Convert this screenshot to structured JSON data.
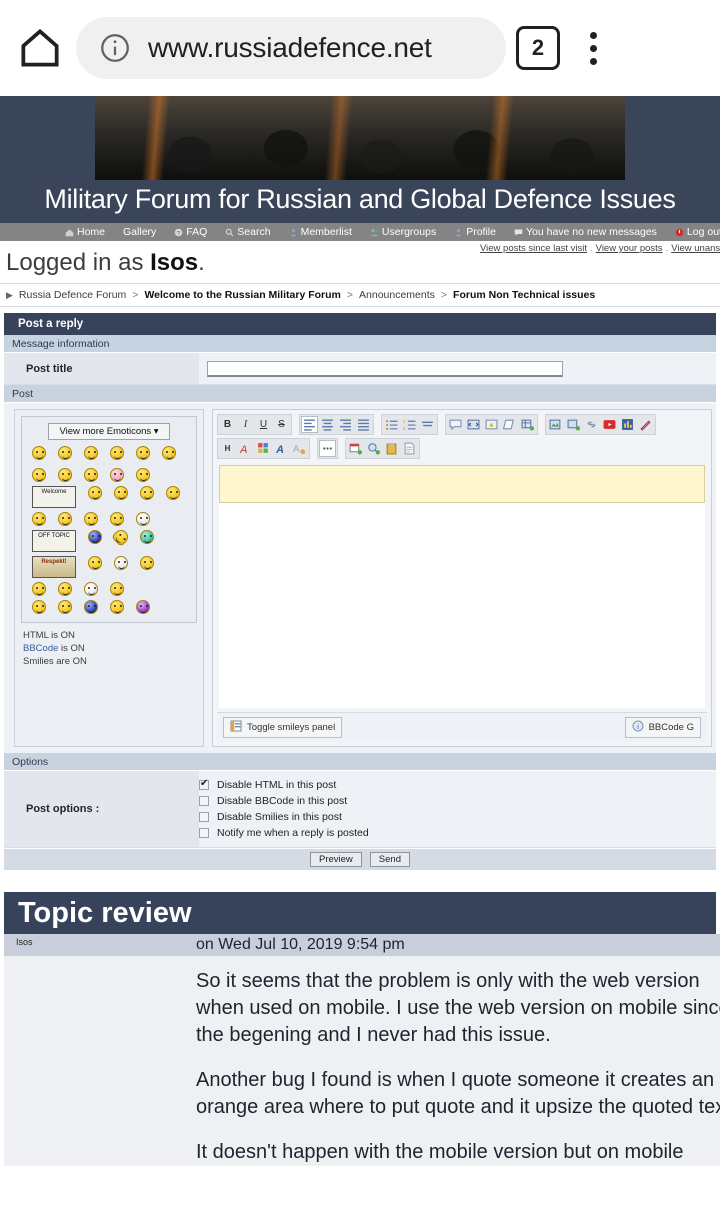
{
  "browser": {
    "home_icon": "home-icon",
    "info_icon": "info-icon",
    "url": "www.russiadefence.net",
    "tab_count": "2",
    "menu_icon": "overflow-menu-icon"
  },
  "site": {
    "banner_title": "Military Forum for Russian and Global Defence Issues"
  },
  "nav": {
    "items": [
      {
        "label": "Home",
        "icon": "home-icon"
      },
      {
        "label": "Gallery",
        "icon": "gallery-icon"
      },
      {
        "label": "FAQ",
        "icon": "faq-icon"
      },
      {
        "label": "Search",
        "icon": "search-icon"
      },
      {
        "label": "Memberlist",
        "icon": "memberlist-icon"
      },
      {
        "label": "Usergroups",
        "icon": "usergroups-icon"
      },
      {
        "label": "Profile",
        "icon": "profile-icon"
      },
      {
        "label": "You have no new messages",
        "icon": "messages-icon"
      },
      {
        "label": "Log out [ Iso",
        "icon": "logout-icon"
      }
    ]
  },
  "user": {
    "logged_prefix": "Logged in as",
    "username": "Isos",
    "logged_suffix": ".",
    "quicklinks": [
      "View posts since last visit",
      "View your posts",
      "View unanswered"
    ]
  },
  "breadcrumb": {
    "arrow_icon": "breadcrumb-arrow-icon",
    "items": [
      "Russia Defence Forum",
      "Welcome to the Russian Military Forum",
      "Announcements",
      "Forum Non Technical issues"
    ],
    "separator": ">"
  },
  "post_form": {
    "header": "Post a reply",
    "message_info_header": "Message information",
    "post_title_label": "Post title",
    "post_title_value": "",
    "post_header": "Post"
  },
  "smileys": {
    "view_more_label": "View more Emoticons",
    "dropdown_icon": "chevron-down-icon",
    "sign_welcome": "Welcome",
    "sign_offtopic": "OFF TOPIC",
    "sign_respekt": "Respekt!",
    "meta": {
      "html_status": "HTML is ON",
      "bbcode_link": "BBCode",
      "bbcode_status": "is ON",
      "smilies_status": "Smilies are ON"
    }
  },
  "toolbar": {
    "row1": [
      {
        "name": "bold-button",
        "glyph": "B"
      },
      {
        "name": "italic-button",
        "glyph": "I"
      },
      {
        "name": "underline-button",
        "glyph": "U"
      },
      {
        "name": "strikethrough-button",
        "glyph": "S"
      },
      {
        "name": "align-left-button",
        "glyph": "align-left-icon"
      },
      {
        "name": "align-center-button",
        "glyph": "align-center-icon"
      },
      {
        "name": "align-right-button",
        "glyph": "align-right-icon"
      },
      {
        "name": "align-justify-button",
        "glyph": "align-justify-icon"
      },
      {
        "name": "bullet-list-button",
        "glyph": "bullet-list-icon"
      },
      {
        "name": "numbered-list-button",
        "glyph": "numbered-list-icon"
      },
      {
        "name": "horizontal-rule-button",
        "glyph": "horizontal-rule-icon"
      },
      {
        "name": "quote-button",
        "glyph": "quote-icon"
      },
      {
        "name": "code-button",
        "glyph": "code-icon"
      },
      {
        "name": "spoiler-button",
        "glyph": "spoiler-icon"
      },
      {
        "name": "hide-button",
        "glyph": "hide-icon"
      },
      {
        "name": "table-button",
        "glyph": "table-icon"
      },
      {
        "name": "insert-image-button",
        "glyph": "image-icon"
      },
      {
        "name": "upload-image-button",
        "glyph": "upload-image-icon"
      },
      {
        "name": "insert-link-button",
        "glyph": "link-icon"
      },
      {
        "name": "youtube-button",
        "glyph": "youtube-icon"
      },
      {
        "name": "poll-button",
        "glyph": "chart-icon"
      },
      {
        "name": "signature-button",
        "glyph": "pen-icon"
      }
    ],
    "row2": [
      {
        "name": "heading-button",
        "glyph": "H"
      },
      {
        "name": "font-face-button",
        "glyph": "font-face-icon"
      },
      {
        "name": "font-color-button",
        "glyph": "color-palette-icon"
      },
      {
        "name": "font-size-button",
        "glyph": "font-size-icon"
      },
      {
        "name": "remove-format-button",
        "glyph": "remove-format-icon"
      },
      {
        "name": "more-button",
        "glyph": "ellipsis-icon"
      },
      {
        "name": "calendar-button",
        "glyph": "calendar-icon"
      },
      {
        "name": "search-insert-button",
        "glyph": "search-plus-icon"
      },
      {
        "name": "paste-button",
        "glyph": "clipboard-icon"
      },
      {
        "name": "page-button",
        "glyph": "page-icon"
      }
    ],
    "toggle_smileys_label": "Toggle smileys panel",
    "toggle_smileys_icon": "panel-icon",
    "bbcode_guide_label": "BBCode G",
    "bbcode_guide_icon": "info-icon"
  },
  "options": {
    "header": "Options",
    "label": "Post options :",
    "checkboxes": [
      {
        "label": "Disable HTML in this post",
        "checked": true
      },
      {
        "label": "Disable BBCode in this post",
        "checked": false
      },
      {
        "label": "Disable Smilies in this post",
        "checked": false
      },
      {
        "label": "Notify me when a reply is posted",
        "checked": false
      }
    ],
    "preview_label": "Preview",
    "send_label": "Send"
  },
  "topic_review": {
    "header": "Topic review",
    "author": "Isos",
    "date": "on Wed Jul 10, 2019 9:54 pm",
    "paragraphs": [
      "So it seems that the problem is only with the web version",
      "when used on mobile. I use the web version on mobile since",
      "the begening and I never had this issue.",
      "Another bug I found is when I quote someone it creates an",
      "orange area where to put quote and it upsize the quoted tex",
      "It doesn't happen with the mobile version but on mobile"
    ]
  },
  "colors": {
    "banner_bg": "#3a4559",
    "navbar_bg": "#848484",
    "panel_header": "#36435a",
    "subheader": "#c8d3e2",
    "quote_highlight": "#fdf6cf"
  }
}
